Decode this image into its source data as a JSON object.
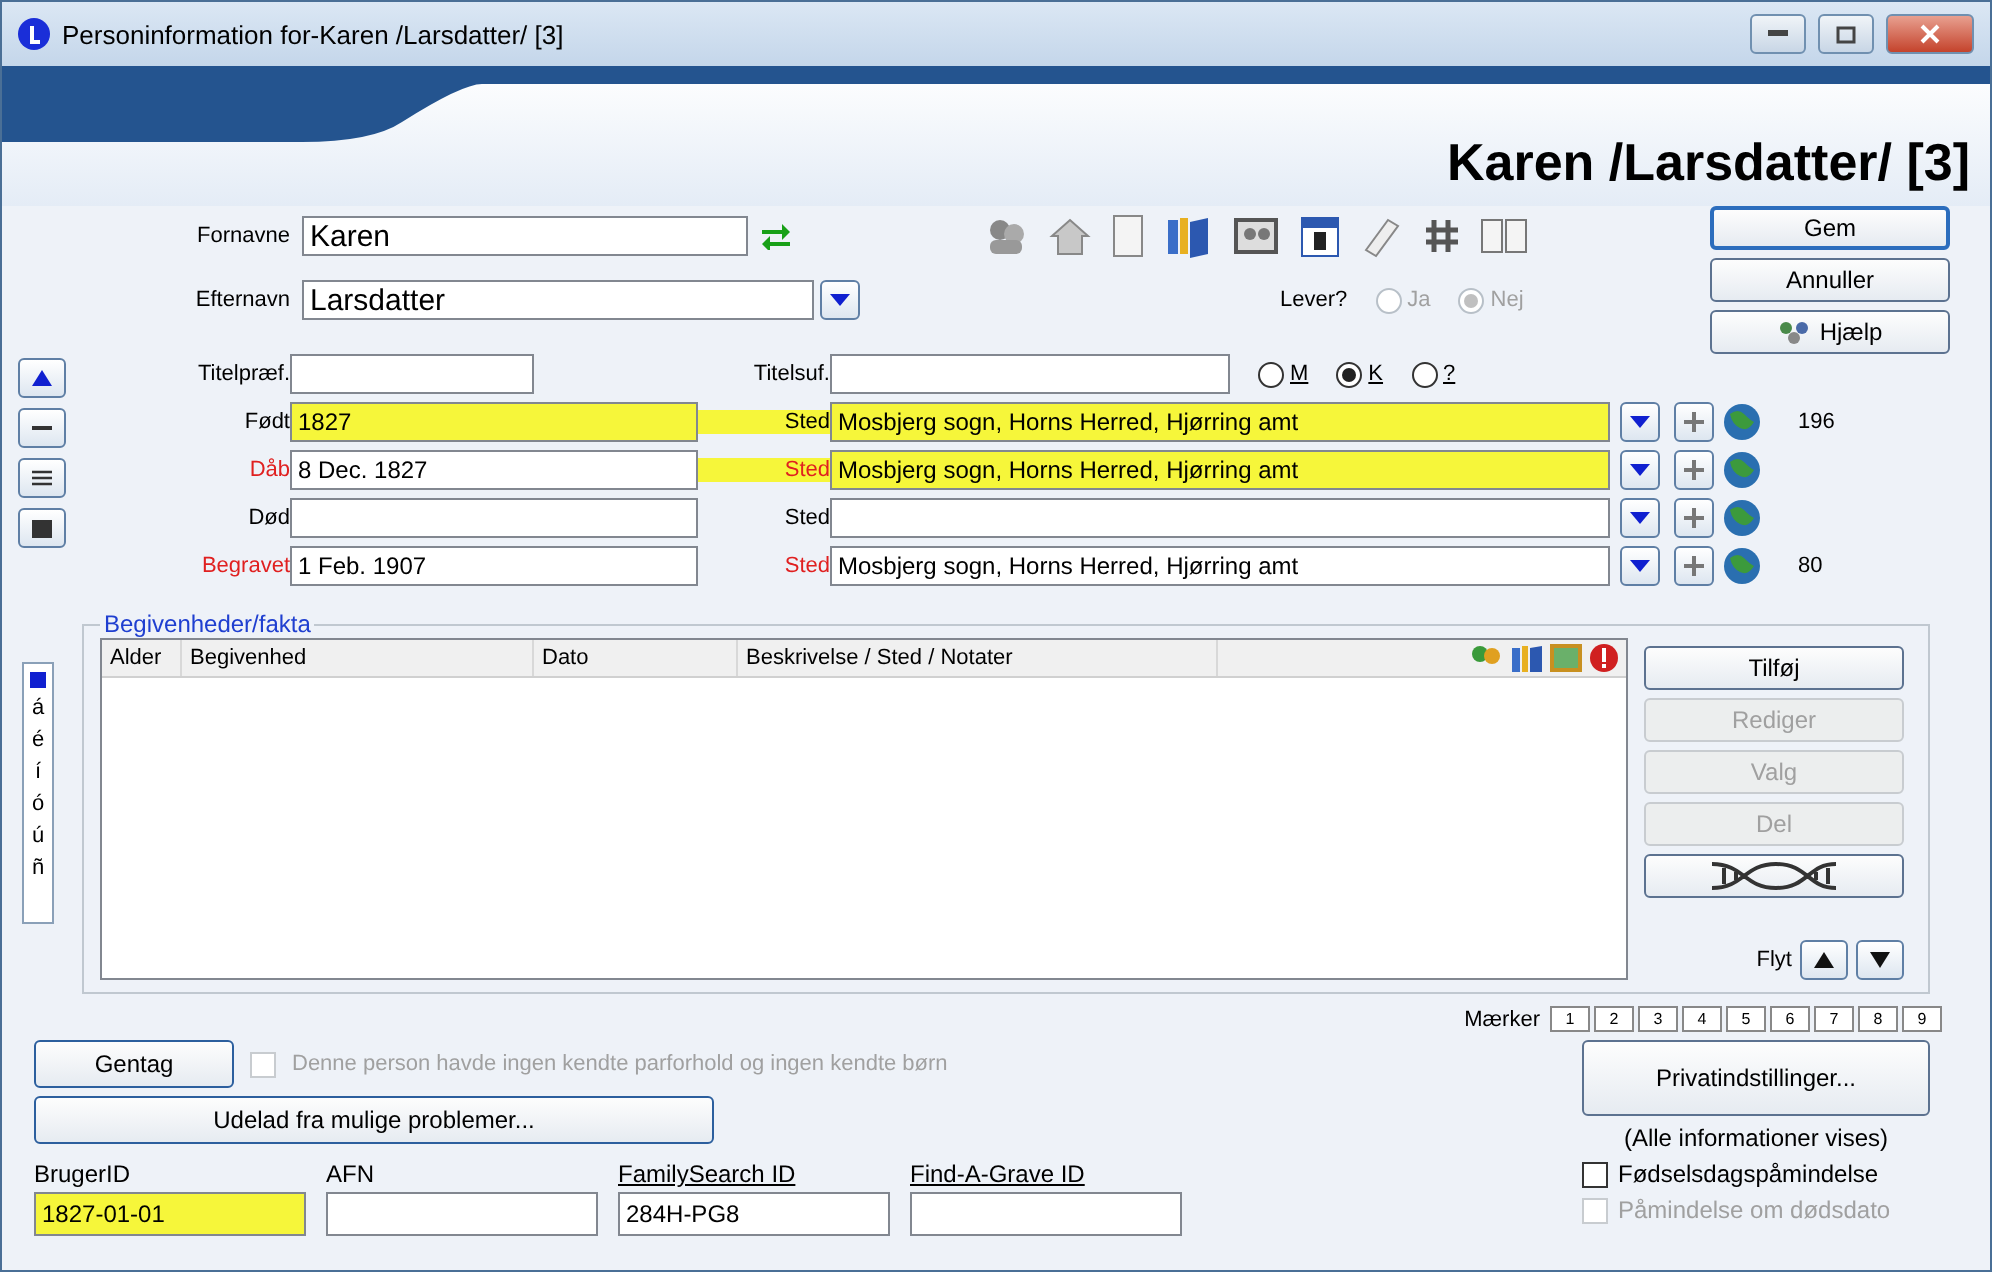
{
  "window": {
    "title": "Personinformation for-Karen /Larsdatter/ [3]"
  },
  "header": {
    "name": "Karen /Larsdatter/ [3]"
  },
  "name_fields": {
    "first": {
      "label": "Fornavne",
      "value": "Karen"
    },
    "last": {
      "label": "Efternavn",
      "value": "Larsdatter"
    },
    "prefix": {
      "label": "Titelpræf."
    },
    "suffix": {
      "label": "Titelsuf."
    }
  },
  "living": {
    "label": "Lever?",
    "disabled": true,
    "options": [
      {
        "label": "Ja",
        "selected": false
      },
      {
        "label": "Nej",
        "selected": true
      }
    ]
  },
  "sex": [
    {
      "label": "M",
      "selected": false
    },
    {
      "label": "K",
      "selected": true
    },
    {
      "label": "?",
      "selected": false
    }
  ],
  "actions": [
    {
      "label": "Gem",
      "kind": "default"
    },
    {
      "label": "Annuller",
      "kind": "plain"
    },
    {
      "label": "Hjælp",
      "kind": "help"
    }
  ],
  "events": [
    {
      "label": "Født",
      "value": "1827",
      "place_label": "Sted",
      "place": "Mosbjerg sogn, Horns Herred, Hjørring amt",
      "sourced": false,
      "date_highlighted": true,
      "place_highlighted": true,
      "count": "196"
    },
    {
      "label": "Dåb",
      "value": "8 Dec. 1827",
      "place_label": "Sted",
      "place": "Mosbjerg sogn, Horns Herred, Hjørring amt",
      "sourced": true,
      "date_highlighted": false,
      "place_highlighted": true
    },
    {
      "label": "Død",
      "place_label": "Sted",
      "sourced": false,
      "date_highlighted": false,
      "place_highlighted": false
    },
    {
      "label": "Begravet",
      "value": "1 Feb. 1907",
      "place_label": "Sted",
      "place": "Mosbjerg sogn, Horns Herred, Hjørring amt",
      "sourced": true,
      "date_highlighted": false,
      "place_highlighted": false,
      "count": "80"
    }
  ],
  "accents": [
    "á",
    "é",
    "í",
    "ó",
    "ú",
    "ñ"
  ],
  "facts": {
    "legend": "Begivenheder/fakta",
    "columns": [
      "Alder",
      "Begivenhed",
      "Dato",
      "Beskrivelse / Sted / Notater"
    ],
    "buttons": [
      {
        "label": "Tilføj",
        "disabled": false
      },
      {
        "label": "Rediger",
        "disabled": true
      },
      {
        "label": "Valg",
        "disabled": true
      },
      {
        "label": "Del",
        "disabled": true
      }
    ],
    "move_label": "Flyt"
  },
  "markers": {
    "label": "Mærker",
    "boxes": [
      "1",
      "2",
      "3",
      "4",
      "5",
      "6",
      "7",
      "8",
      "9"
    ]
  },
  "repeat_button": "Gentag",
  "no_family": {
    "label": "Denne person havde ingen kendte parforhold og ingen kendte børn",
    "checked": false,
    "disabled": true
  },
  "problems_button": "Udelad fra mulige problemer...",
  "ids": [
    {
      "label": "BrugerID",
      "value": "1827-01-01",
      "link": false,
      "highlighted": true
    },
    {
      "label": "AFN",
      "link": false,
      "highlighted": false
    },
    {
      "label": "FamilySearch ID",
      "value": "284H-PG8",
      "link": true,
      "highlighted": false
    },
    {
      "label": "Find-A-Grave ID",
      "link": true,
      "highlighted": false
    }
  ],
  "privacy": {
    "button": "Privatindstillinger...",
    "note": "(Alle informationer vises)"
  },
  "reminders": [
    {
      "label": "Fødselsdagspåmindelse",
      "checked": false,
      "disabled": false
    },
    {
      "label": "Påmindelse om dødsdato",
      "checked": false,
      "disabled": true
    }
  ]
}
